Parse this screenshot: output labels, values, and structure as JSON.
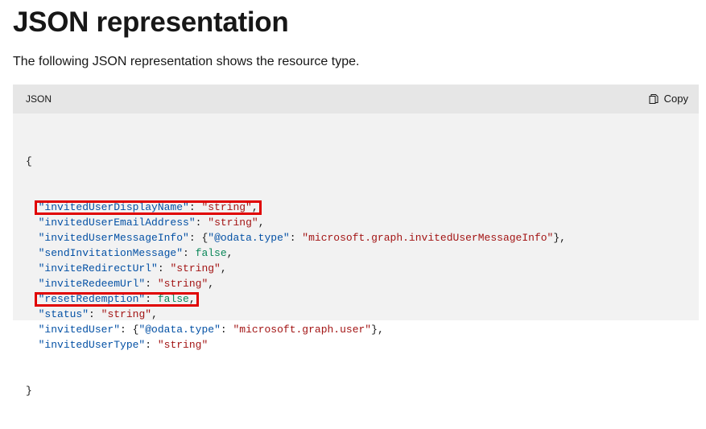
{
  "page": {
    "title": "JSON representation",
    "intro": "The following JSON representation shows the resource type."
  },
  "code_block": {
    "language": "JSON",
    "copy_label": "Copy",
    "copy_icon": "copy-icon",
    "open_brace": "{",
    "close_brace": "}",
    "lines": [
      {
        "key": "\"invitedUserDisplayName\"",
        "value": "\"string\"",
        "value_type": "string",
        "suffix": ",",
        "highlighted": true
      },
      {
        "key": "\"invitedUserEmailAddress\"",
        "value": "\"string\"",
        "value_type": "string",
        "suffix": ",",
        "highlighted": false
      },
      {
        "key": "\"invitedUserMessageInfo\"",
        "obj_key": "\"@odata.type\"",
        "obj_value": "\"microsoft.graph.invitedUserMessageInfo\"",
        "value_type": "object",
        "suffix": ",",
        "highlighted": false
      },
      {
        "key": "\"sendInvitationMessage\"",
        "value": "false",
        "value_type": "literal",
        "suffix": ",",
        "highlighted": false
      },
      {
        "key": "\"inviteRedirectUrl\"",
        "value": "\"string\"",
        "value_type": "string",
        "suffix": ",",
        "highlighted": false
      },
      {
        "key": "\"inviteRedeemUrl\"",
        "value": "\"string\"",
        "value_type": "string",
        "suffix": ",",
        "highlighted": false
      },
      {
        "key": "\"resetRedemption\"",
        "value": "false",
        "value_type": "literal",
        "suffix": ",",
        "highlighted": true
      },
      {
        "key": "\"status\"",
        "value": "\"string\"",
        "value_type": "string",
        "suffix": ",",
        "highlighted": false
      },
      {
        "key": "\"invitedUser\"",
        "obj_key": "\"@odata.type\"",
        "obj_value": "\"microsoft.graph.user\"",
        "value_type": "object",
        "suffix": ",",
        "highlighted": false
      },
      {
        "key": "\"invitedUserType\"",
        "value": "\"string\"",
        "value_type": "string",
        "suffix": "",
        "highlighted": false
      }
    ]
  },
  "colors": {
    "key": "#0451a5",
    "string": "#a31515",
    "literal": "#098658",
    "highlight_border": "#e00000",
    "code_background": "#f2f2f2",
    "code_header_background": "#e6e6e6"
  }
}
